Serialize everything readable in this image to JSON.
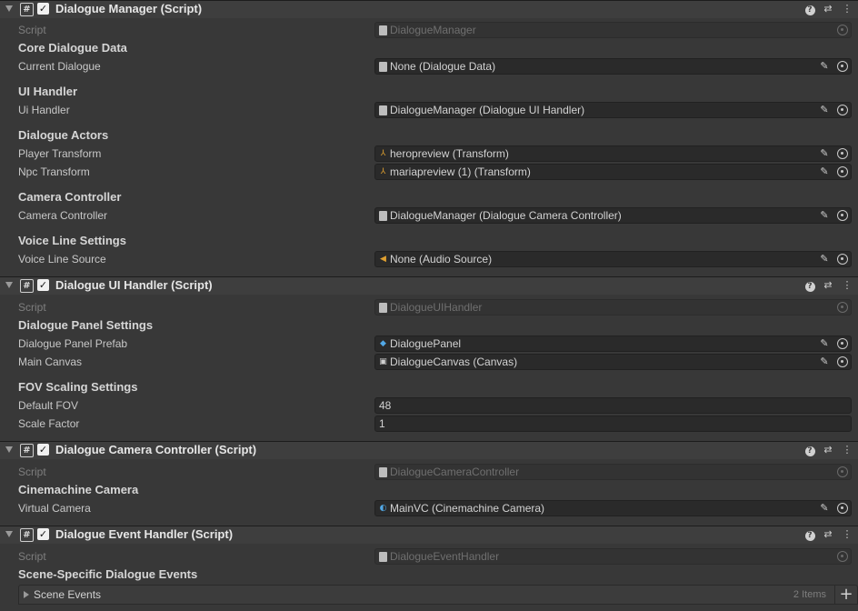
{
  "colors": {
    "background": "#383838",
    "header": "#3e3e3e",
    "field": "#2a2a2a",
    "asset_icon": "#e0a030",
    "prefab_icon": "#52a8e6"
  },
  "dialogue_manager": {
    "title": "Dialogue Manager (Script)",
    "script_label": "Script",
    "script_value": "DialogueManager",
    "section_core": "Core Dialogue Data",
    "current_dialogue_label": "Current Dialogue",
    "current_dialogue_value": "None (Dialogue Data)",
    "section_ui": "UI Handler",
    "ui_handler_label": "Ui Handler",
    "ui_handler_value": "DialogueManager (Dialogue UI Handler)",
    "section_actors": "Dialogue Actors",
    "player_transform_label": "Player Transform",
    "player_transform_value": "heropreview (Transform)",
    "npc_transform_label": "Npc Transform",
    "npc_transform_value": "mariapreview (1) (Transform)",
    "section_camera": "Camera Controller",
    "camera_controller_label": "Camera Controller",
    "camera_controller_value": "DialogueManager (Dialogue Camera Controller)",
    "section_voice": "Voice Line Settings",
    "voice_line_label": "Voice Line Source",
    "voice_line_value": "None (Audio Source)"
  },
  "dialogue_ui_handler": {
    "title": "Dialogue UI Handler (Script)",
    "script_label": "Script",
    "script_value": "DialogueUIHandler",
    "section_panel": "Dialogue Panel Settings",
    "panel_prefab_label": "Dialogue Panel Prefab",
    "panel_prefab_value": "DialoguePanel",
    "main_canvas_label": "Main Canvas",
    "main_canvas_value": "DialogueCanvas (Canvas)",
    "section_fov": "FOV Scaling Settings",
    "default_fov_label": "Default FOV",
    "default_fov_value": "48",
    "scale_factor_label": "Scale Factor",
    "scale_factor_value": "1"
  },
  "dialogue_camera_controller": {
    "title": "Dialogue Camera Controller (Script)",
    "script_label": "Script",
    "script_value": "DialogueCameraController",
    "section_cine": "Cinemachine Camera",
    "virtual_camera_label": "Virtual Camera",
    "virtual_camera_value": "MainVC (Cinemachine Camera)"
  },
  "dialogue_event_handler": {
    "title": "Dialogue Event Handler (Script)",
    "script_label": "Script",
    "script_value": "DialogueEventHandler",
    "section_events": "Scene-Specific Dialogue Events",
    "scene_events_label": "Scene Events",
    "scene_events_count": "2 Items"
  },
  "icons": {
    "fold": "triangle-down-icon",
    "script": "hash-icon",
    "checkbox": "check-icon",
    "help": "question-icon",
    "presets": "sliders-icon",
    "menu": "kebab-icon",
    "pencil": "pencil-icon",
    "target": "object-picker-icon",
    "add": "plus-icon"
  }
}
